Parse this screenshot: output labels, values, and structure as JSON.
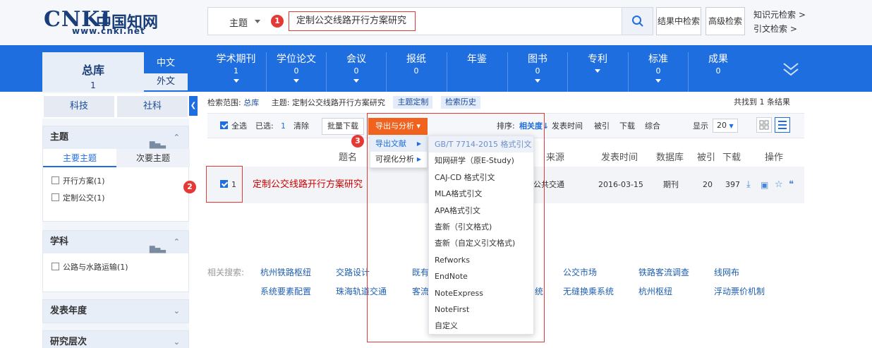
{
  "header": {
    "logo_mark": "CNKI",
    "logo_cn": "中国知网",
    "logo_url": "www.cnki.net",
    "search_field": "主题",
    "search_query": "定制公交线路开行方案研究",
    "btn_in_result": "结果中检索",
    "btn_advanced": "高级检索",
    "link_knowledge": "知识元检索",
    "link_citation": "引文检索",
    "marker_1": "1"
  },
  "nav": {
    "total_label": "总库",
    "total_count": "1",
    "lang_cn": "中文",
    "lang_foreign": "外文",
    "items": [
      {
        "label": "学术期刊",
        "count": "1"
      },
      {
        "label": "学位论文",
        "count": "0"
      },
      {
        "label": "会议",
        "count": "0"
      },
      {
        "label": "报纸",
        "count": "0"
      },
      {
        "label": "年鉴",
        "count": ""
      },
      {
        "label": "图书",
        "count": "0"
      },
      {
        "label": "专利",
        "count": ""
      },
      {
        "label": "标准",
        "count": "0"
      },
      {
        "label": "成果",
        "count": "0"
      }
    ]
  },
  "sidebar": {
    "tab_sci": "科技",
    "tab_social": "社科",
    "topic": {
      "title": "主题",
      "main_tab": "主要主题",
      "sub_tab": "次要主题",
      "items": [
        "开行方案(1)",
        "定制公交(1)"
      ]
    },
    "subject": {
      "title": "学科",
      "items": [
        "公路与水路运输(1)"
      ]
    },
    "year_title": "发表年度",
    "level_title": "研究层次"
  },
  "main": {
    "scope_label": "检索范围:",
    "scope_value": "总库",
    "topic_label": "主题:",
    "topic_value": "定制公交线路开行方案研究",
    "btn_custom": "主题定制",
    "btn_history": "检索历史",
    "found_text": "共找到 1 条结果",
    "toolbar": {
      "select_all": "全选",
      "selected_label": "已选:",
      "selected_count": "1",
      "clear": "清除",
      "batch_download": "批量下载",
      "export": "导出与分析",
      "sort_label": "排序:",
      "sort_relevance": "相关度",
      "sort_date": "发表时间",
      "sort_cited": "被引",
      "sort_download": "下载",
      "sort_mixed": "综合",
      "display_label": "显示",
      "page_size": "20"
    },
    "table_headers": {
      "title": "题名",
      "source": "来源",
      "date": "发表时间",
      "db": "数据库",
      "cited": "被引",
      "downloads": "下载",
      "ops": "操作"
    },
    "row": {
      "index": "1",
      "title": "定制公交线路开行方案研究",
      "source": "公共交通",
      "date": "2016-03-15",
      "db": "期刊",
      "cited": "20",
      "downloads": "397"
    },
    "marker_2": "2",
    "marker_3": "3",
    "related_label": "相关搜索:",
    "related": [
      "杭州铁路枢纽",
      "交路设计",
      "既有",
      "公交市场",
      "铁路客流调查",
      "线网布",
      "系统要素配置",
      "珠海轨道交通",
      "客流",
      "统",
      "无缝换乘系统",
      "杭州枢纽",
      "浮动票价机制"
    ]
  },
  "export_menu": {
    "level1": [
      "导出文献",
      "可视化分析"
    ],
    "level2": [
      "GB/T 7714-2015 格式引文",
      "知网研学（原E-Study)",
      "CAJ-CD 格式引文",
      "MLA格式引文",
      "APA格式引文",
      "查新（引文格式)",
      "查新（自定义引文格式)",
      "Refworks",
      "EndNote",
      "NoteExpress",
      "NoteFirst",
      "自定义"
    ]
  },
  "colors": {
    "brand_blue": "#1f6ee0",
    "accent_orange": "#f0621e",
    "marker_red": "#e53935",
    "link_blue": "#1f5fb0"
  }
}
